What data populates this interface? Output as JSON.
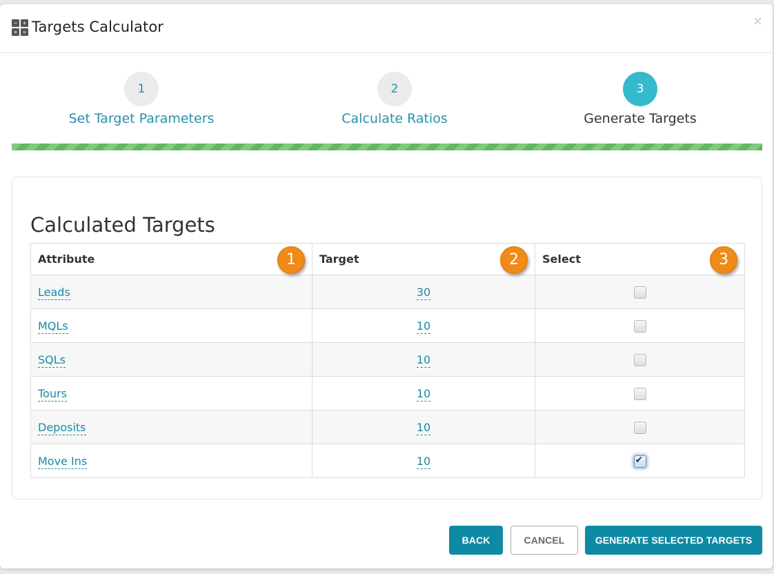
{
  "dialog": {
    "title": "Targets Calculator",
    "close_glyph": "×",
    "icon": "calculator-icon",
    "icon_glyphs": [
      "−",
      "+",
      "×",
      "="
    ]
  },
  "steps": [
    {
      "number": "1",
      "label": "Set Target Parameters",
      "state": "completed"
    },
    {
      "number": "2",
      "label": "Calculate Ratios",
      "state": "completed"
    },
    {
      "number": "3",
      "label": "Generate Targets",
      "state": "active"
    }
  ],
  "progress": {
    "percent": 100,
    "color": "#62b85e"
  },
  "panel": {
    "title": "Calculated Targets",
    "columns": [
      {
        "label": "Attribute",
        "badge": "1"
      },
      {
        "label": "Target",
        "badge": "2"
      },
      {
        "label": "Select",
        "badge": "3"
      }
    ],
    "rows": [
      {
        "attribute": "Leads",
        "target": "30",
        "selected": false
      },
      {
        "attribute": "MQLs",
        "target": "10",
        "selected": false
      },
      {
        "attribute": "SQLs",
        "target": "10",
        "selected": false
      },
      {
        "attribute": "Tours",
        "target": "10",
        "selected": false
      },
      {
        "attribute": "Deposits",
        "target": "10",
        "selected": false
      },
      {
        "attribute": "Move Ins",
        "target": "10",
        "selected": true
      }
    ]
  },
  "buttons": {
    "back": "BACK",
    "cancel": "CANCEL",
    "generate": "GENERATE SELECTED TARGETS"
  },
  "colors": {
    "primary": "#0f8aa4",
    "link": "#1a8aa3",
    "active_step": "#35b9cc",
    "badge": "#f08a18"
  }
}
